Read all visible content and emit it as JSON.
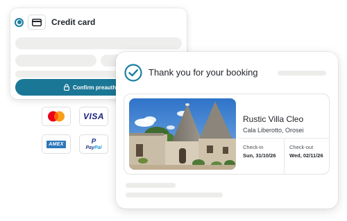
{
  "payment": {
    "method_label": "Credit card",
    "confirm_label": "Confirm preauthorization",
    "logos": {
      "mastercard": {
        "icon": "mastercard-logo",
        "colors": [
          "#eb001b",
          "#f79e1b"
        ]
      },
      "visa": {
        "text": "VISA",
        "color": "#1a237e"
      },
      "amex": {
        "text": "AMEX",
        "color": "#2e77bb"
      },
      "paypal": {
        "mark": "P",
        "text_pay": "Pay",
        "text_pal": "Pal"
      }
    },
    "accent": "#1b7796"
  },
  "booking": {
    "title": "Thank you for your booking",
    "icon": "check-circle-icon",
    "accent": "#1b7fa3",
    "listing": {
      "name": "Rustic Villa Cleo",
      "location": "Cala Liberotto, Orosei",
      "checkin_label": "Check-in",
      "checkin_value": "Sun, 31/10/26",
      "checkout_label": "Check-out",
      "checkout_value": "Wed, 02/11/26"
    }
  }
}
